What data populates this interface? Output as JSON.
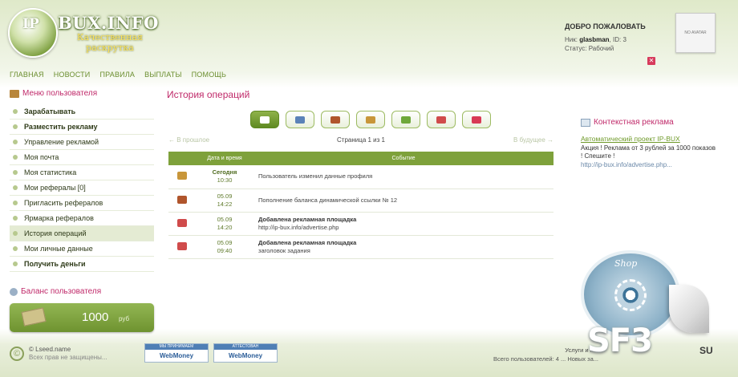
{
  "header": {
    "logo_mark": "IP",
    "logo_text": "BUX.INFO",
    "slogan_line1": "Качественная",
    "slogan_line2": "раскрутка",
    "welcome_title": "ДОБРО ПОЖАЛОВАТЬ",
    "user_line": "Ник: glasbman, ID: 3",
    "user_nick_label": "Ник:",
    "user_nick": "glasbman",
    "user_id_label": ", ID: 3",
    "status_line": "Статус: Рабочий",
    "avatar_text": "NO AVATAR",
    "logout_icon": "close-icon"
  },
  "topnav": [
    "ГЛАВНАЯ",
    "НОВОСТИ",
    "ПРАВИЛА",
    "ВЫПЛАТЫ",
    "ПОМОЩЬ"
  ],
  "sidebar": {
    "title": "Меню пользователя",
    "items": [
      {
        "label": "Зарабатывать",
        "bold": true
      },
      {
        "label": "Разместить рекламу",
        "bold": true
      },
      {
        "label": "Управление рекламой"
      },
      {
        "label": "Моя почта"
      },
      {
        "label": "Моя статистика"
      },
      {
        "label": "Мои рефералы [0]"
      },
      {
        "label": "Пригласить рефералов"
      },
      {
        "label": "Ярмарка рефералов"
      },
      {
        "label": "История операций",
        "active": true
      },
      {
        "label": "Мои личные данные"
      },
      {
        "label": "Получить деньги",
        "bold": true
      }
    ],
    "balance_title": "Баланс пользователя",
    "balance_amount": "1000",
    "balance_currency": "руб"
  },
  "main": {
    "title": "История операций",
    "filter_icons": [
      {
        "name": "all-icon",
        "color": "#ffffff"
      },
      {
        "name": "user-icon",
        "color": "#5b82b8"
      },
      {
        "name": "wallet-icon",
        "color": "#b0552c"
      },
      {
        "name": "lock-icon",
        "color": "#c8963a"
      },
      {
        "name": "money-icon",
        "color": "#6fa83a"
      },
      {
        "name": "megaphone-icon",
        "color": "#d04b4b"
      },
      {
        "name": "heart-icon",
        "color": "#d83a55"
      }
    ],
    "pager_prev": "← В прошлое",
    "pager_info": "Страница 1 из 1",
    "pager_next": "В будущее →",
    "table_headers": [
      "Дата и время",
      "Событие"
    ],
    "rows": [
      {
        "icon": "lock-icon",
        "icon_color": "#c8963a",
        "date": "Сегодня",
        "time": "10:30",
        "date_bold": true,
        "event": "Пользователь изменил данные профиля",
        "event_bold": "",
        "event_sub": ""
      },
      {
        "icon": "wallet-icon",
        "icon_color": "#b0552c",
        "date": "05.09",
        "time": "14:22",
        "event": "Пополнение баланса динамической ссылки № 12",
        "event_bold": "",
        "event_sub": ""
      },
      {
        "icon": "megaphone-icon",
        "icon_color": "#d04b4b",
        "date": "05.09",
        "time": "14:20",
        "event": "",
        "event_bold": "Добавлена рекламная площадка",
        "event_sub": "http://ip-bux.info/advertise.php"
      },
      {
        "icon": "megaphone-icon",
        "icon_color": "#d04b4b",
        "date": "05.09",
        "time": "09:40",
        "event": "",
        "event_bold": "Добавлена рекламная площадка",
        "event_sub": "заголовок задания"
      }
    ]
  },
  "context_ad": {
    "title": "Контекстная реклама",
    "link": "Автоматический проект IP-BUX",
    "text": "Акция ! Реклама от 3 рублей за 1000 показов ! Спешите !",
    "url": "http://ip-bux.info/advertise.php..."
  },
  "shop_badge": {
    "text": "Shop"
  },
  "footer": {
    "copy_line1": "© Lseed.name",
    "copy_line2": "Всех прав не защищены...",
    "webmoney": [
      {
        "top": "МЫ ПРИНИМАЕМ",
        "bottom": "WebMoney"
      },
      {
        "top": "АТТЕСТОВАН",
        "bottom": "WebMoney"
      }
    ],
    "right_line1": "Услуги и п...",
    "right_line2": "Всего пользователей: 4 ... Новых за...",
    "watermark": "SF3",
    "watermark_suffix": "SU"
  }
}
